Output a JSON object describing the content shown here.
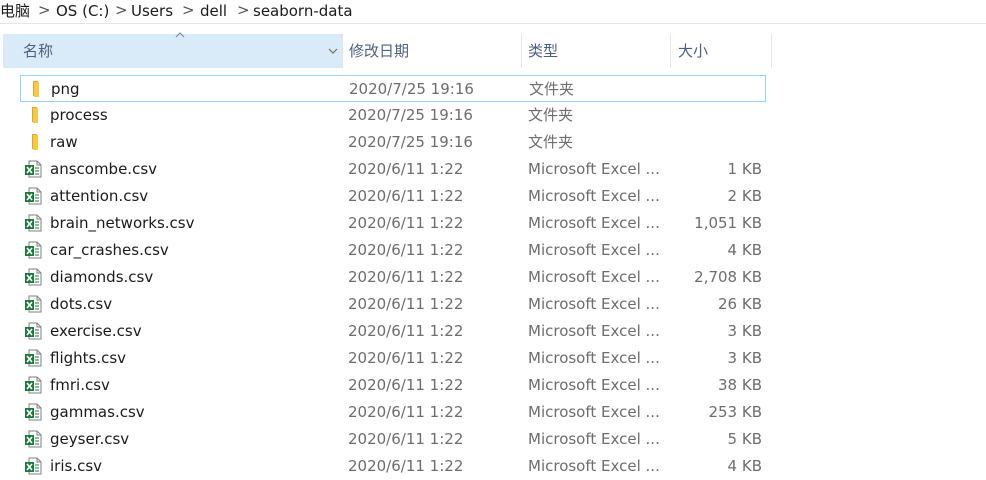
{
  "breadcrumb": {
    "items": [
      "电脑",
      "OS (C:)",
      "Users",
      "dell",
      "seaborn-data"
    ],
    "separator": ">"
  },
  "columns": {
    "name": "名称",
    "date": "修改日期",
    "type": "类型",
    "size": "大小"
  },
  "colors": {
    "accent": "#d9ebf9",
    "selection_border": "#99d1ff",
    "folder": "#f4c84a",
    "excel": "#1d7a3c"
  },
  "rows": [
    {
      "name": "png",
      "date": "2020/7/25 19:16",
      "type": "文件夹",
      "size": "",
      "icon": "folder-icon"
    },
    {
      "name": "process",
      "date": "2020/7/25 19:16",
      "type": "文件夹",
      "size": "",
      "icon": "folder-icon"
    },
    {
      "name": "raw",
      "date": "2020/7/25 19:16",
      "type": "文件夹",
      "size": "",
      "icon": "folder-icon"
    },
    {
      "name": "anscombe.csv",
      "date": "2020/6/11 1:22",
      "type": "Microsoft Excel ...",
      "size": "1 KB",
      "icon": "excel-file-icon"
    },
    {
      "name": "attention.csv",
      "date": "2020/6/11 1:22",
      "type": "Microsoft Excel ...",
      "size": "2 KB",
      "icon": "excel-file-icon"
    },
    {
      "name": "brain_networks.csv",
      "date": "2020/6/11 1:22",
      "type": "Microsoft Excel ...",
      "size": "1,051 KB",
      "icon": "excel-file-icon"
    },
    {
      "name": "car_crashes.csv",
      "date": "2020/6/11 1:22",
      "type": "Microsoft Excel ...",
      "size": "4 KB",
      "icon": "excel-file-icon"
    },
    {
      "name": "diamonds.csv",
      "date": "2020/6/11 1:22",
      "type": "Microsoft Excel ...",
      "size": "2,708 KB",
      "icon": "excel-file-icon"
    },
    {
      "name": "dots.csv",
      "date": "2020/6/11 1:22",
      "type": "Microsoft Excel ...",
      "size": "26 KB",
      "icon": "excel-file-icon"
    },
    {
      "name": "exercise.csv",
      "date": "2020/6/11 1:22",
      "type": "Microsoft Excel ...",
      "size": "3 KB",
      "icon": "excel-file-icon"
    },
    {
      "name": "flights.csv",
      "date": "2020/6/11 1:22",
      "type": "Microsoft Excel ...",
      "size": "3 KB",
      "icon": "excel-file-icon"
    },
    {
      "name": "fmri.csv",
      "date": "2020/6/11 1:22",
      "type": "Microsoft Excel ...",
      "size": "38 KB",
      "icon": "excel-file-icon"
    },
    {
      "name": "gammas.csv",
      "date": "2020/6/11 1:22",
      "type": "Microsoft Excel ...",
      "size": "253 KB",
      "icon": "excel-file-icon"
    },
    {
      "name": "geyser.csv",
      "date": "2020/6/11 1:22",
      "type": "Microsoft Excel ...",
      "size": "5 KB",
      "icon": "excel-file-icon"
    },
    {
      "name": "iris.csv",
      "date": "2020/6/11 1:22",
      "type": "Microsoft Excel ...",
      "size": "4 KB",
      "icon": "excel-file-icon"
    }
  ]
}
